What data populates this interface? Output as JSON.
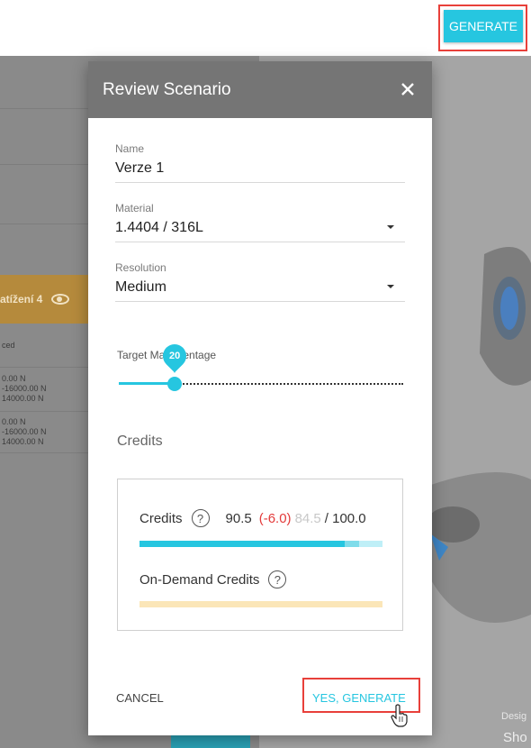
{
  "topbar": {
    "generate_label": "GENERATE"
  },
  "background": {
    "load_tab": "atížení 4",
    "row_label": "ced",
    "row1": [
      "0.00 N",
      "-16000.00 N",
      "14000.00 N"
    ],
    "row2": [
      "0.00 N",
      "-16000.00 N",
      "14000.00 N"
    ],
    "design_label": "Desig",
    "show_label": "Sho"
  },
  "dialog": {
    "title": "Review Scenario",
    "name_label": "Name",
    "name_value": "Verze 1",
    "material_label": "Material",
    "material_value": "1.4404 / 316L",
    "resolution_label": "Resolution",
    "resolution_value": "Medium",
    "slider_label": "Target Ma  ercentage",
    "slider_value": "20",
    "credits_heading": "Credits",
    "credits": {
      "label": "Credits",
      "current": "90.5",
      "delta": "(-6.0)",
      "after": "84.5",
      "max": "/ 100.0",
      "ondemand_label": "On-Demand Credits",
      "help_glyph": "?"
    },
    "cancel_label": "CANCEL",
    "confirm_label": "YES, GENERATE"
  },
  "colors": {
    "accent": "#26c6e0",
    "highlight": "#e8403a",
    "header": "#757575"
  }
}
